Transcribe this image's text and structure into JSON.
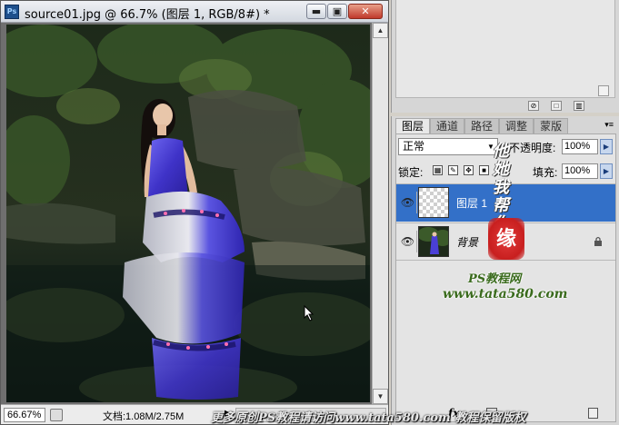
{
  "document_window": {
    "title": "source01.jpg @ 66.7% (图层 1, RGB/8#) *",
    "app_icon_label": "Ps",
    "minimize_glyph": "▬",
    "maximize_glyph": "▣",
    "close_glyph": "✕"
  },
  "status_bar": {
    "zoom": "66.67%",
    "doc_info": "文档:1.08M/2.75M",
    "menu_arrow": "▶"
  },
  "layers_panel": {
    "tabs": [
      {
        "label": "图层",
        "active": true
      },
      {
        "label": "通道",
        "active": false
      },
      {
        "label": "路径",
        "active": false
      },
      {
        "label": "调整",
        "active": false
      },
      {
        "label": "蒙版",
        "active": false
      }
    ],
    "menu_glyph": "▾≡",
    "blend_mode": "正常",
    "opacity_label": "不透明度:",
    "opacity_value": "100%",
    "lock_label": "锁定:",
    "fill_label": "填充:",
    "fill_value": "100%",
    "layers": [
      {
        "name": "图层 1",
        "selected": true,
        "visible": true,
        "thumbnail": "transparent-checker",
        "locked": false,
        "italic": false
      },
      {
        "name": "背景",
        "selected": false,
        "visible": true,
        "thumbnail": "photo",
        "locked": true,
        "italic": true
      }
    ],
    "bottom_tools": [
      "link-icon",
      "fx-icon",
      "mask-icon",
      "adjustment-icon",
      "group-icon",
      "new-layer-icon",
      "trash-icon"
    ],
    "fx_label": "fx."
  },
  "watermark": {
    "handwriting": "他她我帮你",
    "seal": "缘",
    "site_name": "PS教程网",
    "site_url": "www.tata580.com",
    "bottom_text": "更多原创PS教程请访问www.tata580.com 教程保留版权"
  },
  "colors": {
    "selection_blue": "#3370c8",
    "panel_gray": "#d6d6d6",
    "dress_blue": "#4a3fd6",
    "seal_red": "#d42a2a"
  }
}
